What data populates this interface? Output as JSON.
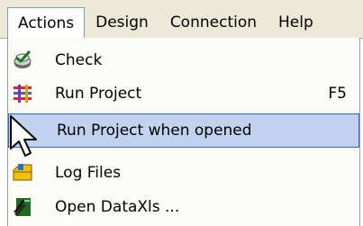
{
  "menubar": {
    "items": [
      {
        "label": "Actions",
        "active": true
      },
      {
        "label": "Design"
      },
      {
        "label": "Connection"
      },
      {
        "label": "Help"
      }
    ]
  },
  "actions_menu": {
    "items": [
      {
        "label": "Check",
        "icon": "check-icon"
      },
      {
        "label": "Run Project",
        "shortcut": "F5",
        "icon": "run-project-icon"
      },
      {
        "label": "Run Project when opened",
        "highlighted": true
      },
      {
        "label": "Log Files",
        "icon": "log-files-icon"
      },
      {
        "label": "Open DataXls ...",
        "icon": "open-dataxls-icon"
      }
    ]
  },
  "colors": {
    "menubar_bg": "#ece9d8",
    "highlight_bg": "#c1d2ee",
    "highlight_border": "#316ac5",
    "menu_bg": "#fbfbf8"
  },
  "cursor": {
    "icon": "arrow-cursor-icon"
  }
}
